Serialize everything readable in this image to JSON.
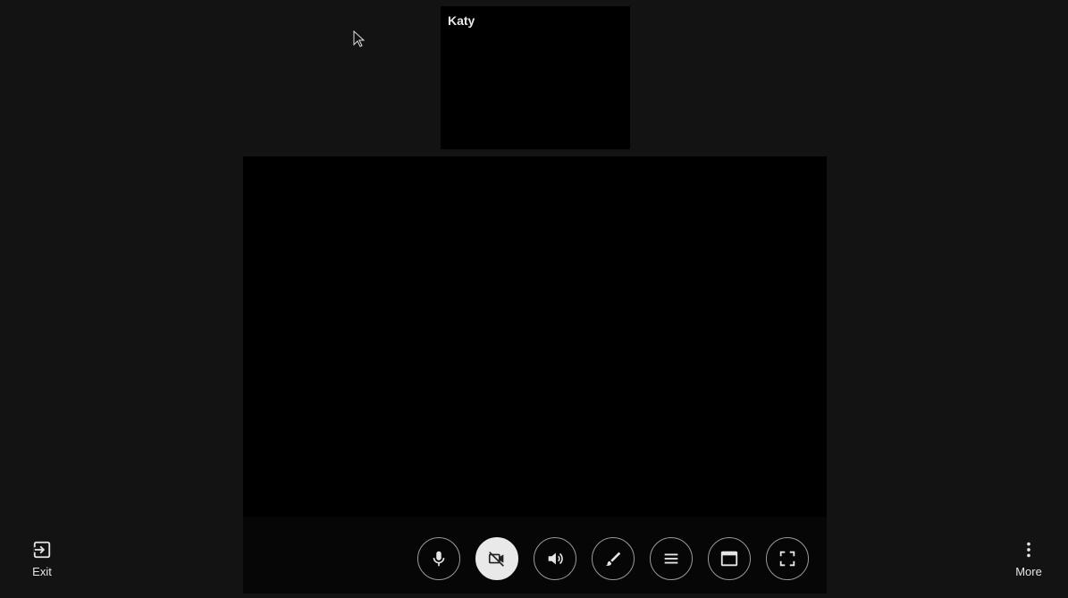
{
  "participant": {
    "name": "Katy"
  },
  "controls": [
    {
      "id": "mic",
      "icon": "microphone-icon",
      "active": false
    },
    {
      "id": "camera",
      "icon": "camera-off-icon",
      "active": true
    },
    {
      "id": "speaker",
      "icon": "speaker-icon",
      "active": false
    },
    {
      "id": "draw",
      "icon": "brush-icon",
      "active": false
    },
    {
      "id": "menu",
      "icon": "menu-lines-icon",
      "active": false
    },
    {
      "id": "window",
      "icon": "window-icon",
      "active": false
    },
    {
      "id": "fullscreen",
      "icon": "fullscreen-icon",
      "active": false
    }
  ],
  "exit": {
    "label": "Exit",
    "icon": "exit-icon"
  },
  "more": {
    "label": "More",
    "icon": "more-vertical-icon"
  },
  "colors": {
    "background": "#131313",
    "video": "#000000",
    "control_bar": "#060606",
    "button_border": "#9a9a9a",
    "active_button": "#e9e9e9"
  }
}
